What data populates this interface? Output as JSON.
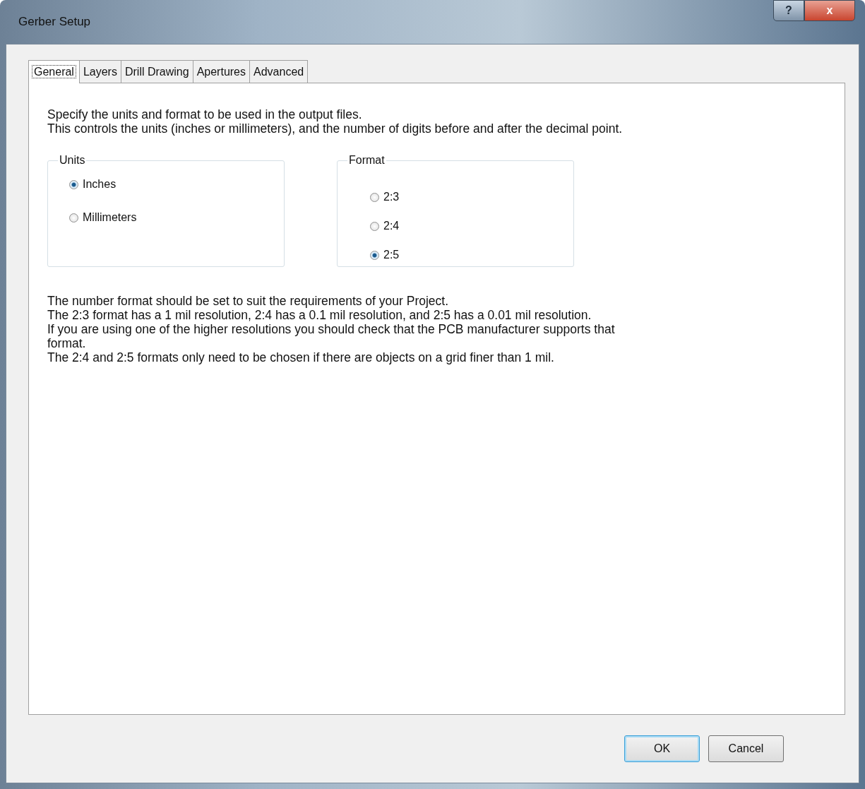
{
  "window": {
    "title": "Gerber Setup",
    "help_button": "?",
    "close_button": "x"
  },
  "tabs": [
    {
      "label": "General",
      "selected": true
    },
    {
      "label": "Layers",
      "selected": false
    },
    {
      "label": "Drill Drawing",
      "selected": false
    },
    {
      "label": "Apertures",
      "selected": false
    },
    {
      "label": "Advanced",
      "selected": false
    }
  ],
  "intro": [
    "Specify the units and format to be used in the output files.",
    "This controls the units (inches or millimeters), and the number of digits before and after the decimal point."
  ],
  "groups": [
    {
      "title": "Units",
      "options": [
        {
          "label": "Inches",
          "selected": true
        },
        {
          "label": "Millimeters",
          "selected": false
        }
      ]
    },
    {
      "title": "Format",
      "options": [
        {
          "label": "2:3",
          "selected": false
        },
        {
          "label": "2:4",
          "selected": false
        },
        {
          "label": "2:5",
          "selected": true
        }
      ]
    }
  ],
  "notes": [
    "The number format should be set to suit the requirements of your Project.",
    "The 2:3 format has a 1 mil resolution, 2:4 has a 0.1 mil resolution, and 2:5 has a 0.01 mil resolution.",
    "If you are using one of the higher resolutions you should check that the PCB manufacturer supports that format.",
    "The 2:4 and 2:5 formats only need to be chosen if there are objects on a grid finer than 1 mil."
  ],
  "buttons": [
    "OK",
    "Cancel"
  ]
}
